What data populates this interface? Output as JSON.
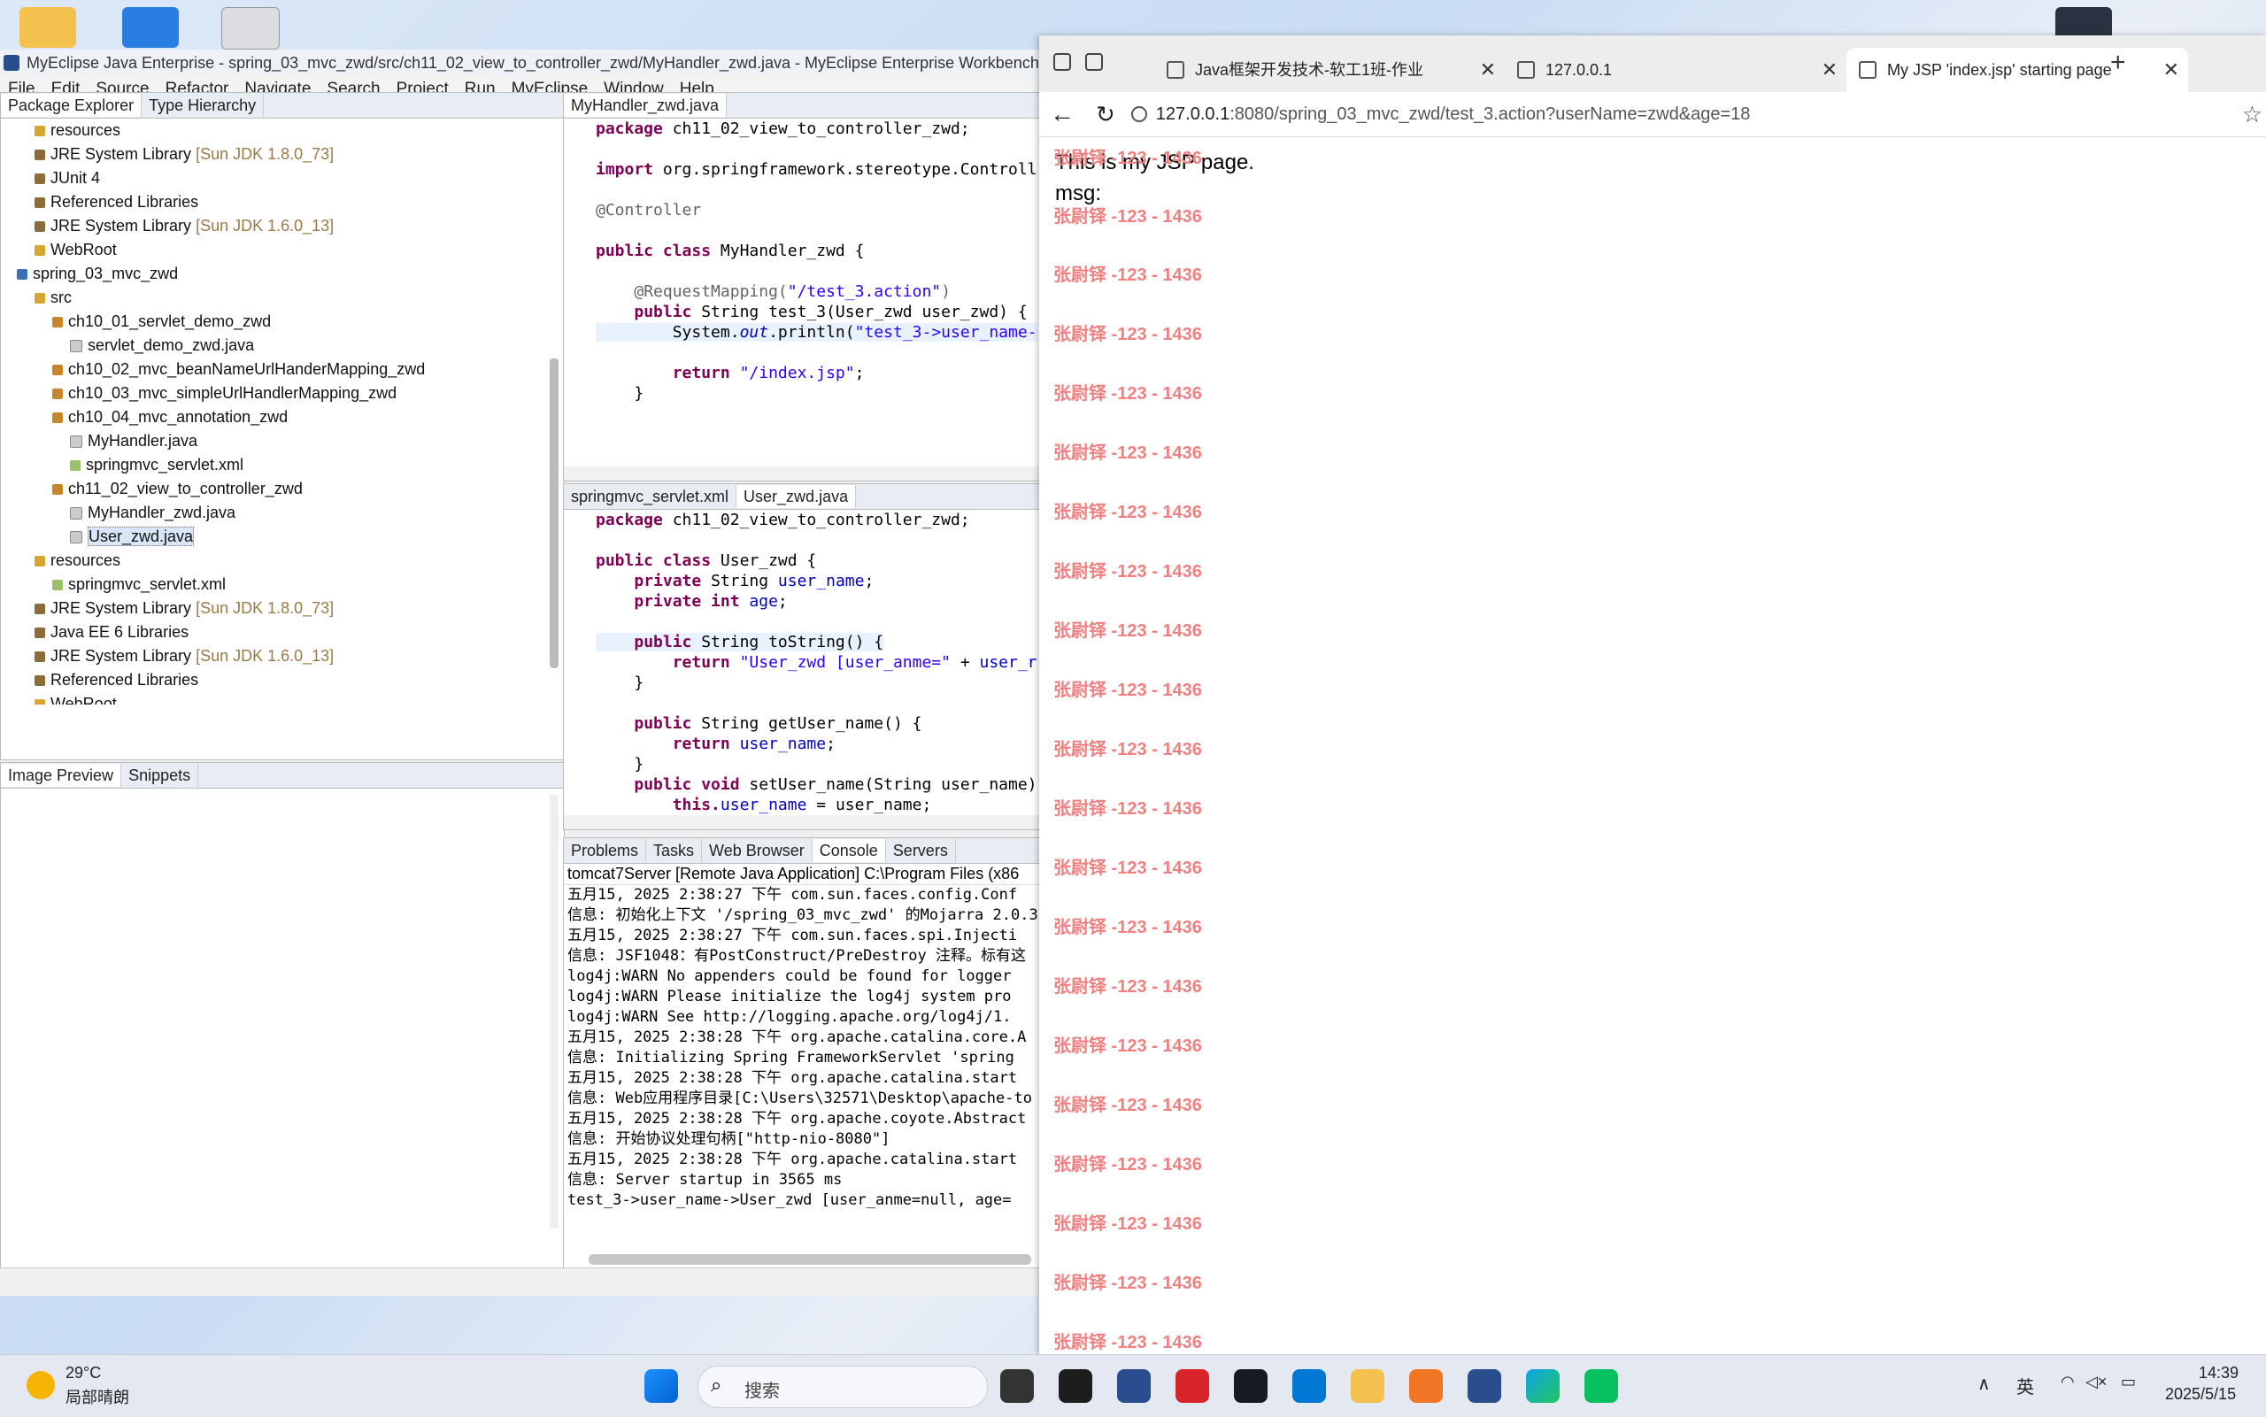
{
  "ide": {
    "title": "MyEclipse Java Enterprise - spring_03_mvc_zwd/src/ch11_02_view_to_controller_zwd/MyHandler_zwd.java - MyEclipse Enterprise Workbench",
    "menu": [
      "File",
      "Edit",
      "Source",
      "Refactor",
      "Navigate",
      "Search",
      "Project",
      "Run",
      "MyEclipse",
      "Window",
      "Help"
    ],
    "package_explorer": {
      "tabs": [
        "Package Explorer",
        "Type Hierarchy"
      ],
      "items": [
        {
          "label": "resources",
          "extra": ""
        },
        {
          "label": "JRE System Library",
          "extra": "[Sun JDK 1.8.0_73]"
        },
        {
          "label": "JUnit 4",
          "extra": ""
        },
        {
          "label": "Referenced Libraries",
          "extra": ""
        },
        {
          "label": "JRE System Library",
          "extra": "[Sun JDK 1.6.0_13]"
        },
        {
          "label": "WebRoot",
          "extra": ""
        },
        {
          "label": "spring_03_mvc_zwd",
          "extra": ""
        },
        {
          "label": "src",
          "extra": ""
        },
        {
          "label": "ch10_01_servlet_demo_zwd",
          "extra": ""
        },
        {
          "label": "servlet_demo_zwd.java",
          "extra": ""
        },
        {
          "label": "ch10_02_mvc_beanNameUrlHanderMapping_zwd",
          "extra": ""
        },
        {
          "label": "ch10_03_mvc_simpleUrlHandlerMapping_zwd",
          "extra": ""
        },
        {
          "label": "ch10_04_mvc_annotation_zwd",
          "extra": ""
        },
        {
          "label": "MyHandler.java",
          "extra": ""
        },
        {
          "label": "springmvc_servlet.xml",
          "extra": ""
        },
        {
          "label": "ch11_02_view_to_controller_zwd",
          "extra": ""
        },
        {
          "label": "MyHandler_zwd.java",
          "extra": ""
        },
        {
          "label": "User_zwd.java",
          "extra": ""
        },
        {
          "label": "resources",
          "extra": ""
        },
        {
          "label": "springmvc_servlet.xml",
          "extra": ""
        },
        {
          "label": "JRE System Library",
          "extra": "[Sun JDK 1.8.0_73]"
        },
        {
          "label": "Java EE 6 Libraries",
          "extra": ""
        },
        {
          "label": "JRE System Library",
          "extra": "[Sun JDK 1.6.0_13]"
        },
        {
          "label": "Referenced Libraries",
          "extra": ""
        },
        {
          "label": "WebRoot",
          "extra": ""
        }
      ]
    },
    "image_preview": {
      "tabs": [
        "Image Preview",
        "Snippets"
      ]
    },
    "editor1": {
      "tab": "MyHandler_zwd.java",
      "lines": {
        "l1a": "package ",
        "l1b": "ch11_02_view_to_controller_zwd;",
        "l2a": "import ",
        "l2b": "org.springframework.stereotype.Controll",
        "l3": "@Controller",
        "l4a": "public class ",
        "l4b": "MyHandler_zwd {",
        "l5a": "@RequestMapping(",
        "l5b": "\"/test_3.action\"",
        "l5c": ")",
        "l6a": "public ",
        "l6b": "String test_3(User_zwd user_zwd) {",
        "l7a": "System.",
        "l7b": "out",
        "l7c": ".println(",
        "l7d": "\"test_3->user_name-",
        "l8a": "return ",
        "l8b": "\"/index.jsp\"",
        "l8c": ";",
        "l9": "}"
      }
    },
    "editor2": {
      "tabs": [
        "springmvc_servlet.xml",
        "User_zwd.java"
      ],
      "lines": {
        "l1a": "package ",
        "l1b": "ch11_02_view_to_controller_zwd;",
        "l2a": "public class ",
        "l2b": "User_zwd {",
        "l3a": "private ",
        "l3b": "String ",
        "l3c": "user_name",
        ";": ";",
        "l4a": "private int ",
        "l4b": "age",
        "l5a": "public ",
        "l5b": "String toString() {",
        "l6a": "return ",
        "l6b": "\"User_zwd [user_anme=\"",
        "l6c": " + ",
        "l6d": "user_r",
        "l7": "}",
        "l8a": "public ",
        "l8b": "String getUser_name() {",
        "l9a": "return ",
        "l9b": "user_name",
        "l10": "}",
        "l11a": "public void ",
        "l11b": "setUser_name(String user_name)",
        "l12a": "this.",
        "l12b": "user_name",
        " l12c": " = user_name;"
      }
    },
    "console": {
      "tabs": [
        "Problems",
        "Tasks",
        "Web Browser",
        "Console",
        "Servers"
      ],
      "header": "tomcat7Server [Remote Java Application] C:\\Program Files (x86",
      "lines": [
        "五月15, 2025 2:38:27 下午 com.sun.faces.config.Conf",
        "信息: 初始化上下文 '/spring_03_mvc_zwd' 的Mojarra 2.0.3",
        "五月15, 2025 2:38:27 下午 com.sun.faces.spi.Injecti",
        "信息: JSF1048：有PostConstruct/PreDestroy 注释。标有这",
        "log4j:WARN No appenders could be found for logger",
        "log4j:WARN Please initialize the log4j system pro",
        "log4j:WARN See http://logging.apache.org/log4j/1.",
        "五月15, 2025 2:38:28 下午 org.apache.catalina.core.A",
        "信息: Initializing Spring FrameworkServlet 'spring",
        "五月15, 2025 2:38:28 下午 org.apache.catalina.start",
        "信息: Web应用程序目录[C:\\Users\\32571\\Desktop\\apache-to",
        "五月15, 2025 2:38:28 下午 org.apache.coyote.Abstract",
        "信息: 开始协议处理句柄[\"http-nio-8080\"]",
        "五月15, 2025 2:38:28 下午 org.apache.catalina.start",
        "信息: Server startup in 3565 ms",
        "test_3->user_name->User_zwd [user_anme=null, age="
      ]
    }
  },
  "browser": {
    "tabs": [
      {
        "title": "Java框架开发技术-软工1班-作业"
      },
      {
        "title": "127.0.0.1"
      },
      {
        "title": "My JSP 'index.jsp' starting page"
      }
    ],
    "address_host": "127.0.0.1",
    "address_rest": ":8080/spring_03_mvc_zwd/test_3.action?userName=zwd&age=18",
    "page_line1": "This is my JSP page.",
    "page_line2": "msg:",
    "watermark": "张尉铎 -123 - 1436"
  },
  "taskbar": {
    "weather_temp": "29°C",
    "weather_desc": "局部晴朗",
    "search_placeholder": "搜索",
    "ime": "英",
    "time": "14:39",
    "date": "2025/5/15"
  }
}
